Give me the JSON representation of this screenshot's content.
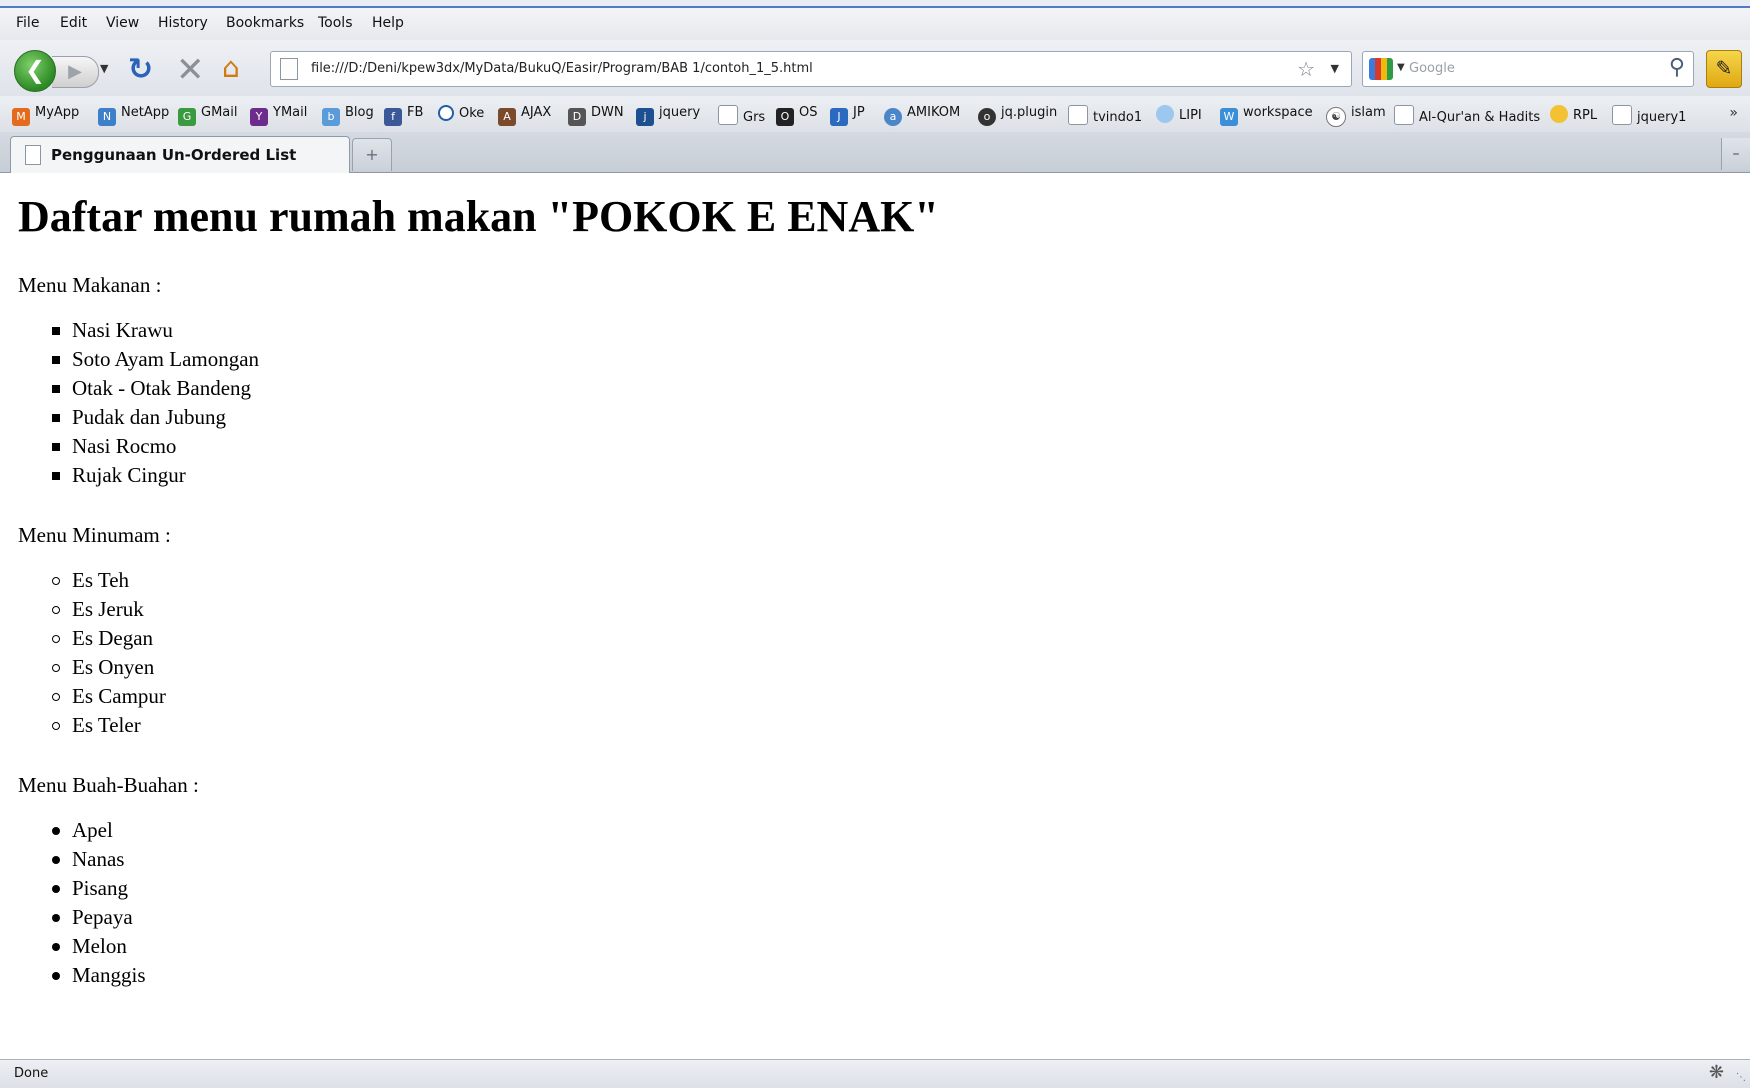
{
  "menu": [
    "File",
    "Edit",
    "View",
    "History",
    "Bookmarks",
    "Tools",
    "Help"
  ],
  "nav": {
    "url": "file:///D:/Deni/kpew3dx/MyData/BukuQ/Easir/Program/BAB 1/contoh_1_5.html",
    "search_placeholder": "Google"
  },
  "bookmarks": [
    "MyApp",
    "NetApp",
    "GMail",
    "YMail",
    "Blog",
    "FB",
    "Oke",
    "AJAX",
    "DWN",
    "jquery",
    "Grs",
    "OS",
    "JP",
    "AMIKOM",
    "jq.plugin",
    "tvindo1",
    "LIPI",
    "workspace",
    "islam",
    "Al-Qur'an & Hadits",
    "RPL",
    "jquery1"
  ],
  "bookmark_more": "»",
  "tab": {
    "title": "Penggunaan Un-Ordered List",
    "new_tab": "+"
  },
  "page": {
    "heading": "Daftar menu rumah makan \"POKOK E ENAK\"",
    "sections": [
      {
        "label": "Menu Makanan :",
        "items": [
          "Nasi Krawu",
          "Soto Ayam Lamongan",
          "Otak - Otak Bandeng",
          "Pudak dan Jubung",
          "Nasi Rocmo",
          "Rujak Cingur"
        ]
      },
      {
        "label": "Menu Minumam :",
        "items": [
          "Es Teh",
          "Es Jeruk",
          "Es Degan",
          "Es Onyen",
          "Es Campur",
          "Es Teler"
        ]
      },
      {
        "label": "Menu Buah-Buahan :",
        "items": [
          "Apel",
          "Nanas",
          "Pisang",
          "Pepaya",
          "Melon",
          "Manggis"
        ]
      }
    ]
  },
  "status": {
    "text": "Done"
  }
}
